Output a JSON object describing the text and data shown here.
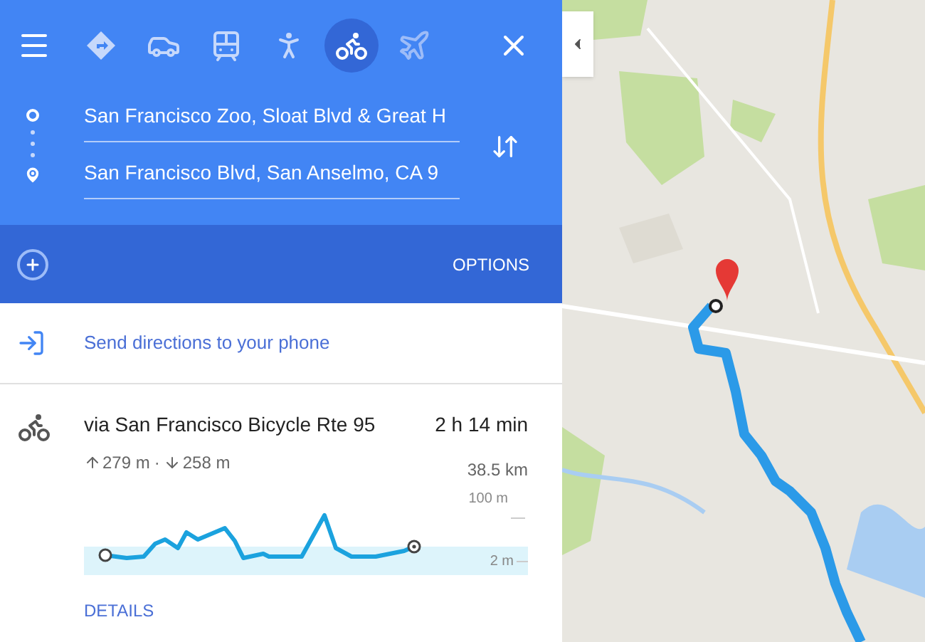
{
  "modes": [
    {
      "kind": "best",
      "selected": false
    },
    {
      "kind": "car",
      "selected": false
    },
    {
      "kind": "transit",
      "selected": false
    },
    {
      "kind": "walk",
      "selected": false
    },
    {
      "kind": "bike",
      "selected": true
    },
    {
      "kind": "flight",
      "selected": false
    }
  ],
  "origin": {
    "value": "San Francisco Zoo, Sloat Blvd & Great H"
  },
  "destination": {
    "value": "San Francisco Blvd, San Anselmo, CA 9"
  },
  "options_button": "OPTIONS",
  "send_link": "Send directions to your phone",
  "route": {
    "name": "via San Francisco Bicycle Rte 95",
    "duration": "2 h 14 min",
    "ascent": "279 m",
    "descent": "258 m",
    "separator": "·",
    "distance": "38.5 km",
    "elevation_max": "100 m",
    "elevation_min": "2 m",
    "details_link": "DETAILS"
  }
}
